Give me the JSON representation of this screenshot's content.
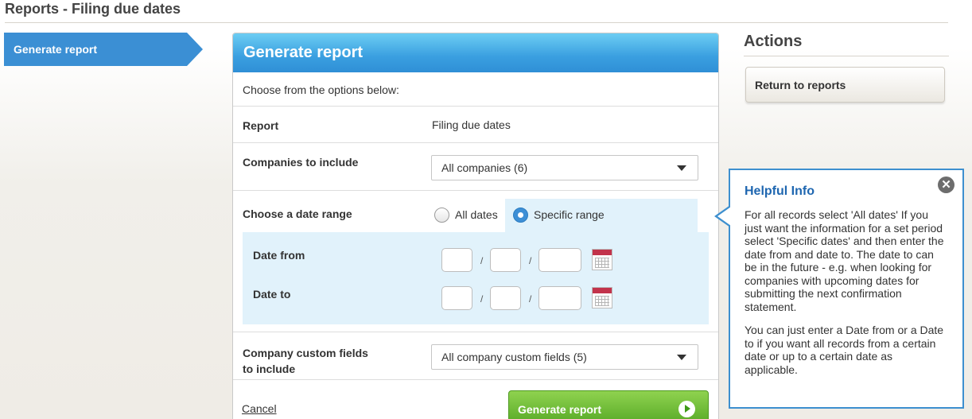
{
  "page": {
    "title": "Reports - Filing due dates"
  },
  "nav": {
    "active_item": "Generate report"
  },
  "panel": {
    "header": "Generate report",
    "intro": "Choose from the options below:",
    "report": {
      "label": "Report",
      "value": "Filing due dates"
    },
    "companies": {
      "label": "Companies to include",
      "selected": "All companies (6)"
    },
    "date_range": {
      "label": "Choose a date range",
      "options": [
        {
          "label": "All dates",
          "checked": false
        },
        {
          "label": "Specific range",
          "checked": true
        }
      ],
      "date_from_label": "Date from",
      "date_to_label": "Date to",
      "separator": "/"
    },
    "custom_fields": {
      "label_line1": "Company custom fields",
      "label_line2": "to include",
      "selected": "All company custom fields (5)"
    },
    "cancel_label": "Cancel",
    "generate_label": "Generate report"
  },
  "actions": {
    "title": "Actions",
    "return_label": "Return to reports"
  },
  "info": {
    "title": "Helpful Info",
    "close_glyph": "✕",
    "paragraph1": "For all records select 'All dates' If you just want the information for a set period select 'Specific dates' and then enter the date from and date to. The date to can be in the future - e.g. when looking for companies with upcoming dates for submitting the next confirmation statement.",
    "paragraph2": "You can just enter a Date from or a Date to if you want all records from a certain date or up to a certain date as applicable."
  },
  "colors": {
    "nav_active": "#3b8fd4",
    "header_blue": "#3a9fe0",
    "generate_green": "#5cad2a",
    "info_border": "#3d8fcf",
    "calendar_red": "#c2334b"
  }
}
